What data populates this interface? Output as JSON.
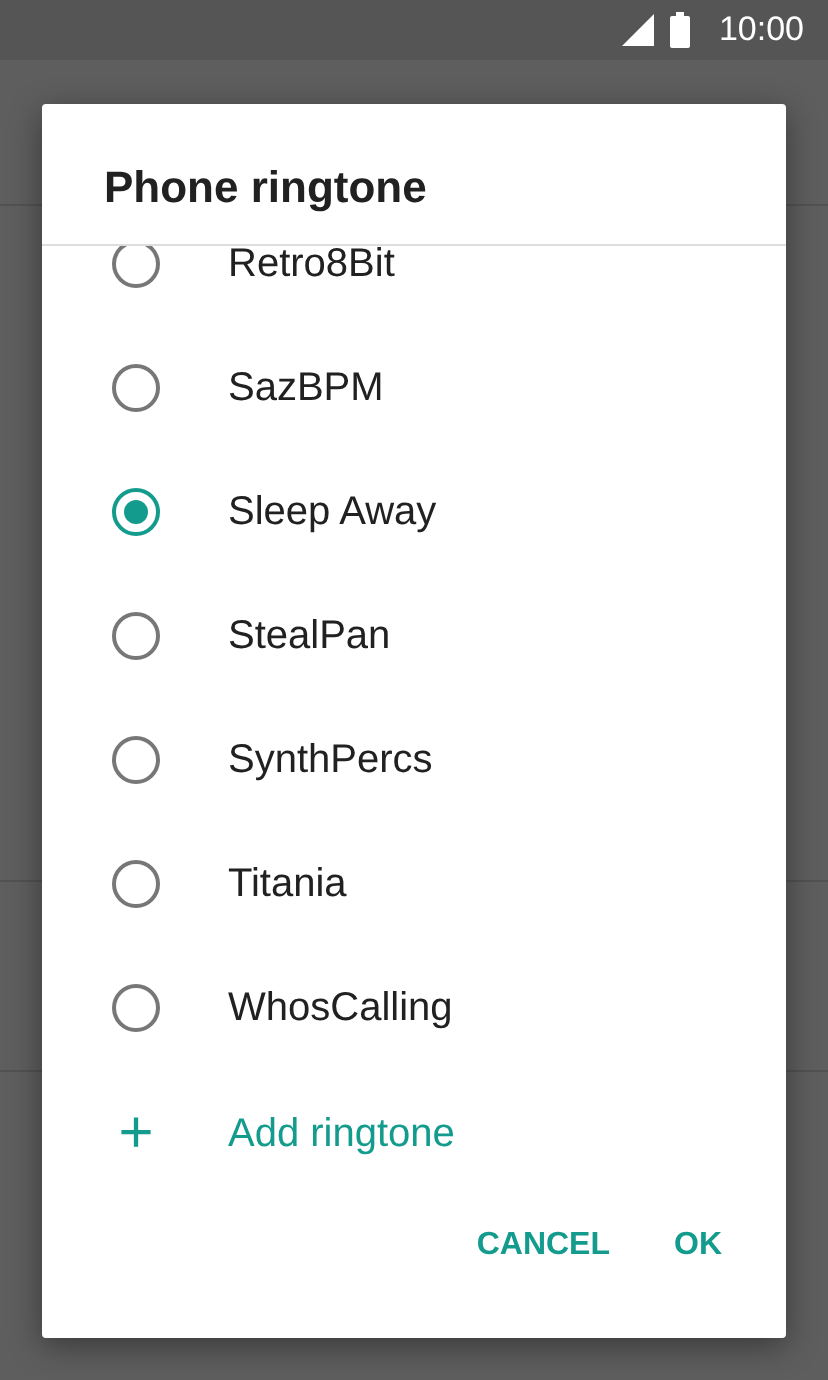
{
  "status_bar": {
    "time": "10:00"
  },
  "dialog": {
    "title": "Phone ringtone",
    "options": [
      {
        "label": "Retro8Bit",
        "selected": false
      },
      {
        "label": "SazBPM",
        "selected": false
      },
      {
        "label": "Sleep Away",
        "selected": true
      },
      {
        "label": "StealPan",
        "selected": false
      },
      {
        "label": "SynthPercs",
        "selected": false
      },
      {
        "label": "Titania",
        "selected": false
      },
      {
        "label": "WhosCalling",
        "selected": false
      }
    ],
    "add_action": {
      "icon": "+",
      "label": "Add ringtone"
    },
    "buttons": [
      "CANCEL",
      "OK"
    ]
  }
}
